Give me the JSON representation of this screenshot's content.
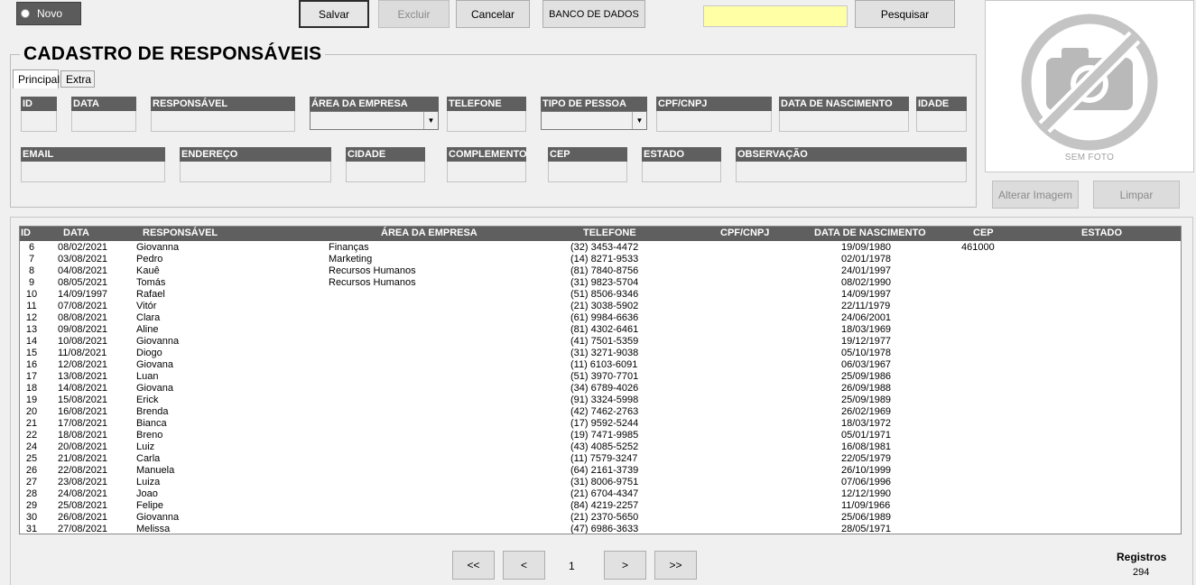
{
  "toolbar": {
    "novo_label": "Novo",
    "salvar_label": "Salvar",
    "excluir_label": "Excluir",
    "cancelar_label": "Cancelar",
    "banco_label": "BANCO DE DADOS",
    "search_value": "",
    "pesquisar_label": "Pesquisar"
  },
  "form": {
    "title": "CADASTRO DE RESPONSÁVEIS",
    "tabs": [
      "Principal",
      "Extra"
    ],
    "fields_row1": [
      "ID",
      "DATA",
      "RESPONSÁVEL",
      "ÁREA DA EMPRESA",
      "TELEFONE",
      "TIPO DE PESSOA",
      "CPF/CNPJ",
      "DATA DE NASCIMENTO",
      "IDADE"
    ],
    "fields_row2": [
      "EMAIL",
      "ENDEREÇO",
      "CIDADE",
      "COMPLEMENTO",
      "CEP",
      "ESTADO",
      "OBSERVAÇÃO"
    ]
  },
  "photo": {
    "caption": "SEM FOTO",
    "alterar_label": "Alterar Imagem",
    "limpar_label": "Limpar"
  },
  "grid": {
    "headers": [
      "ID",
      "DATA",
      "RESPONSÁVEL",
      "ÁREA DA EMPRESA",
      "TELEFONE",
      "CPF/CNPJ",
      "DATA DE NASCIMENTO",
      "CEP",
      "ESTADO"
    ],
    "rows": [
      [
        "6",
        "08/02/2021",
        "Giovanna",
        "Finanças",
        "(32) 3453-4472",
        "19/09/1980",
        "461000"
      ],
      [
        "7",
        "03/08/2021",
        "Pedro",
        "Marketing",
        "(14) 8271-9533",
        "02/01/1978",
        ""
      ],
      [
        "8",
        "04/08/2021",
        "Kauê",
        "Recursos Humanos",
        "(81) 7840-8756",
        "24/01/1997",
        ""
      ],
      [
        "9",
        "08/05/2021",
        "Tomás",
        "Recursos Humanos",
        "(31) 9823-5704",
        "08/02/1990",
        ""
      ],
      [
        "10",
        "14/09/1997",
        "Rafael",
        "",
        "(51) 8506-9346",
        "14/09/1997",
        ""
      ],
      [
        "11",
        "07/08/2021",
        "Vitór",
        "",
        "(21) 3038-5902",
        "22/11/1979",
        ""
      ],
      [
        "12",
        "08/08/2021",
        "Clara",
        "",
        "(61) 9984-6636",
        "24/06/2001",
        ""
      ],
      [
        "13",
        "09/08/2021",
        "Aline",
        "",
        "(81) 4302-6461",
        "18/03/1969",
        ""
      ],
      [
        "14",
        "10/08/2021",
        "Giovanna",
        "",
        "(41) 7501-5359",
        "19/12/1977",
        ""
      ],
      [
        "15",
        "11/08/2021",
        "Diogo",
        "",
        "(31) 3271-9038",
        "05/10/1978",
        ""
      ],
      [
        "16",
        "12/08/2021",
        "Giovana",
        "",
        "(11) 6103-6091",
        "06/03/1967",
        ""
      ],
      [
        "17",
        "13/08/2021",
        "Luan",
        "",
        "(51) 3970-7701",
        "25/09/1986",
        ""
      ],
      [
        "18",
        "14/08/2021",
        "Giovana",
        "",
        "(34) 6789-4026",
        "26/09/1988",
        ""
      ],
      [
        "19",
        "15/08/2021",
        "Erick",
        "",
        "(91) 3324-5998",
        "25/09/1989",
        ""
      ],
      [
        "20",
        "16/08/2021",
        "Brenda",
        "",
        "(42) 7462-2763",
        "26/02/1969",
        ""
      ],
      [
        "21",
        "17/08/2021",
        "Bianca",
        "",
        "(17) 9592-5244",
        "18/03/1972",
        ""
      ],
      [
        "22",
        "18/08/2021",
        "Breno",
        "",
        "(19) 7471-9985",
        "05/01/1971",
        ""
      ],
      [
        "24",
        "20/08/2021",
        "Luiz",
        "",
        "(43) 4085-5252",
        "16/08/1981",
        ""
      ],
      [
        "25",
        "21/08/2021",
        "Carla",
        "",
        "(11) 7579-3247",
        "22/05/1979",
        ""
      ],
      [
        "26",
        "22/08/2021",
        "Manuela",
        "",
        "(64) 2161-3739",
        "26/10/1999",
        ""
      ],
      [
        "27",
        "23/08/2021",
        "Luiza",
        "",
        "(31) 8006-9751",
        "07/06/1996",
        ""
      ],
      [
        "28",
        "24/08/2021",
        "Joao",
        "",
        "(21) 6704-4347",
        "12/12/1990",
        ""
      ],
      [
        "29",
        "25/08/2021",
        "Felipe",
        "",
        "(84) 4219-2257",
        "11/09/1966",
        ""
      ],
      [
        "30",
        "26/08/2021",
        "Giovanna",
        "",
        "(21) 2370-5650",
        "25/06/1989",
        ""
      ],
      [
        "31",
        "27/08/2021",
        "Melissa",
        "",
        "(47) 6986-3633",
        "28/05/1971",
        ""
      ]
    ]
  },
  "pager": {
    "first": "<<",
    "prev": "<",
    "page": "1",
    "next": ">",
    "last": ">>"
  },
  "registros": {
    "label": "Registros",
    "count": "294"
  },
  "colors": {
    "header_gray": "#5f5f5f",
    "search_yellow": "#ffffa6"
  }
}
